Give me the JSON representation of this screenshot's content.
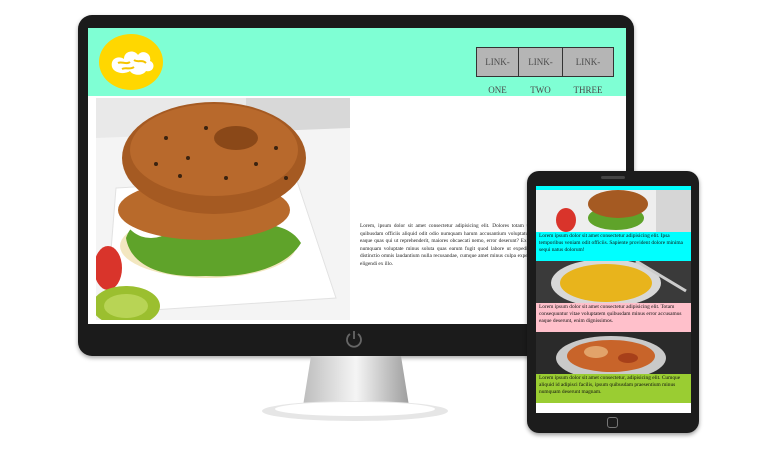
{
  "desktop": {
    "nav": {
      "links": [
        "LINK-ONE",
        "LINK-TWO",
        "LINK-THREE"
      ]
    },
    "hero_text": "Lorem, ipsum dolor sit amet consectetur adipisicing elit. Dolores totam unde distinctio iste? Doloremque sint optio quibusdam officiis aliquid odit odio numquam harum accusantium voluptatum obcaecati architecto unde expedita? Sunt, eaque quas qui ut reprehenderit, maiores obcaecati nemo, error deserunt? Ex unde molestias dolorem dolorum laboriosam numquam voluptate minus soluta quas earum fugit quod labore ut expedita eveniet reiciendis commodi cum veniam distinctio omnis laudantium nulla recusandae, cumque amet minus culpa expedita? Perspiciatis culpa eius odio vel sapiente eligendi ex illo."
  },
  "mobile": {
    "sections": [
      {
        "text": "Lorem ipsum dolor sit amet consectetur adipisicing elit. Ipsa temporibus veniam odit officiis. Sapiente provident dolore minima sequi natus dolorum!"
      },
      {
        "text": "Lorem ipsum dolor sit amet consectetur adipisicing elit. Totam consequuntur vitae voluptatem quibusdam minus error accusamus eaque deserunt, enim dignissimos."
      },
      {
        "text": "Lorem ipsum dolor sit amet consectetur, adipisicing elit. Cumque aliquid id adipisci facilis, ipsum quibusdam praesentium minus numquam deserunt magnam."
      }
    ]
  },
  "colors": {
    "header": "#7fffd4",
    "logo": "#ffd700",
    "section1": "#00ffff",
    "section2": "#ffc0cb",
    "section3": "#9acd32"
  },
  "icons": [
    "logo-icon",
    "power-icon",
    "home-button-icon"
  ]
}
